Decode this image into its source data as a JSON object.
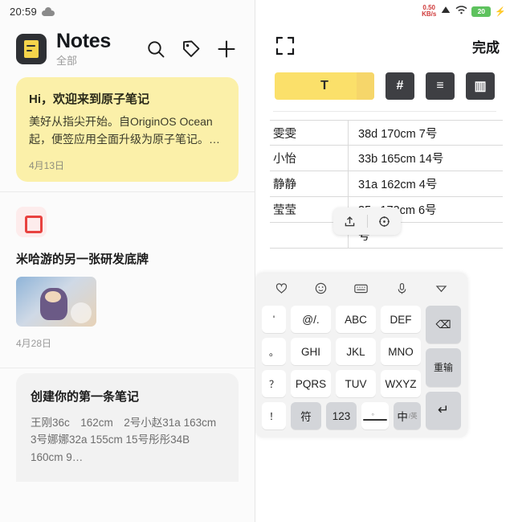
{
  "left": {
    "status": {
      "clock": "20:59",
      "cloud_icon": "cloud-icon"
    },
    "header": {
      "logo_icon": "notes-app-logo",
      "title": "Notes",
      "subtitle": "全部",
      "search_icon": "search-icon",
      "tag_icon": "tag-icon",
      "add_icon": "plus-icon"
    },
    "notes": [
      {
        "style": "yellow",
        "title": "Hi，欢迎来到原子笔记",
        "body": "美好从指尖开始。自OriginOS Ocean 起，便签应用全面升级为原子笔记。…",
        "date": "4月13日"
      },
      {
        "style": "plain",
        "icon": "red-square-icon",
        "title": "米哈游的另一张研发底牌",
        "thumb_icon": "game-character-thumbnail",
        "date": "4月28日"
      },
      {
        "style": "grey",
        "title": "创建你的第一条笔记",
        "body": "王刚36c　162cm　2号小赵31a 163cm　3号娜娜32a 155cm 15号彤彤34B 160cm 9…"
      }
    ]
  },
  "right": {
    "status": {
      "speed_value": "0.50",
      "speed_unit": "KB/s",
      "signal_icon": "signal-icon",
      "wifi_icon": "wifi-icon",
      "battery_level": "20",
      "charging_icon": "charging-bolt-icon"
    },
    "toolbar": {
      "expand_icon": "fullscreen-expand-icon",
      "done_label": "完成"
    },
    "format_bar": [
      {
        "name": "text-style-button",
        "label": "T",
        "active": true
      },
      {
        "name": "heading-button",
        "label": "#",
        "active": false
      },
      {
        "name": "list-button",
        "label": "≡",
        "active": false
      },
      {
        "name": "table-button",
        "label": "▥",
        "active": false
      }
    ],
    "table": {
      "rows": [
        {
          "name": "雯雯",
          "info": "38d 170cm  7号"
        },
        {
          "name": "小怡",
          "info": "33b 165cm 14号"
        },
        {
          "name": "静静",
          "info": "31a  162cm  4号"
        },
        {
          "name": "莹莹",
          "info": "35c 172cm  6号"
        },
        {
          "name": "",
          "info": "号"
        }
      ]
    },
    "mini_toolbar": [
      {
        "name": "share-cell-icon",
        "label": "⇪"
      },
      {
        "name": "move-cell-icon",
        "label": "✥"
      }
    ],
    "keyboard": {
      "top_row": [
        {
          "name": "clipboard-icon",
          "label": "♡"
        },
        {
          "name": "emoji-icon",
          "label": "☺"
        },
        {
          "name": "keyboard-layout-icon",
          "label": "⌨"
        },
        {
          "name": "voice-input-icon",
          "label": "🎤"
        },
        {
          "name": "collapse-keyboard-icon",
          "label": "▽"
        }
      ],
      "left_col": [
        {
          "name": "key-apostrophe",
          "label": "'"
        },
        {
          "name": "key-circle",
          "label": "。"
        },
        {
          "name": "key-question",
          "label": "？"
        },
        {
          "name": "key-exclaim",
          "label": "！"
        }
      ],
      "main_keys": [
        [
          {
            "name": "key-at-dot",
            "label": "@/."
          },
          {
            "name": "key-abc",
            "label": "ABC"
          },
          {
            "name": "key-def",
            "label": "DEF"
          }
        ],
        [
          {
            "name": "key-ghi",
            "label": "GHI"
          },
          {
            "name": "key-jkl",
            "label": "JKL"
          },
          {
            "name": "key-mno",
            "label": "MNO"
          }
        ],
        [
          {
            "name": "key-pqrs",
            "label": "PQRS"
          },
          {
            "name": "key-tuv",
            "label": "TUV"
          },
          {
            "name": "key-wxyz",
            "label": "WXYZ"
          }
        ]
      ],
      "bottom_row": [
        {
          "name": "key-symbols",
          "label": "符"
        },
        {
          "name": "key-numbers",
          "label": "123"
        },
        {
          "name": "key-space",
          "label": ""
        },
        {
          "name": "key-language-toggle",
          "label": "中",
          "sub": "/英"
        }
      ],
      "right_col": [
        {
          "name": "key-backspace",
          "label": "⌫"
        },
        {
          "name": "key-reinput",
          "label": "重输"
        },
        {
          "name": "key-enter",
          "label": "↵"
        }
      ]
    }
  },
  "colors": {
    "yellow_card": "#fbf0a9",
    "accent_yellow": "#fbe06a",
    "dark_key": "#3e3f43",
    "battery_green": "#5ec25e",
    "speed_red": "#cf3a3a"
  }
}
